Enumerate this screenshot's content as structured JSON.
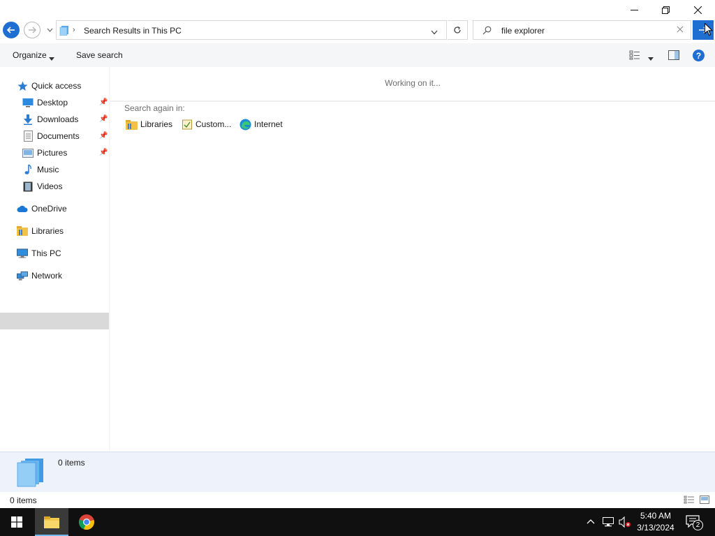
{
  "window": {
    "address_path": "Search Results in This PC",
    "search_query": "file explorer"
  },
  "commands": {
    "organize": "Organize",
    "save_search": "Save search",
    "help": "?"
  },
  "nav_pane": {
    "quick_access": "Quick access",
    "quick_items": [
      {
        "label": "Desktop",
        "icon": "desktop-icon",
        "pinned": true
      },
      {
        "label": "Downloads",
        "icon": "downloads-icon",
        "pinned": true
      },
      {
        "label": "Documents",
        "icon": "documents-icon",
        "pinned": true
      },
      {
        "label": "Pictures",
        "icon": "pictures-icon",
        "pinned": true
      },
      {
        "label": "Music",
        "icon": "music-icon",
        "pinned": false
      },
      {
        "label": "Videos",
        "icon": "videos-icon",
        "pinned": false
      }
    ],
    "onedrive": "OneDrive",
    "libraries": "Libraries",
    "this_pc": "This PC",
    "network": "Network",
    "selected": "This PC"
  },
  "content": {
    "status_message": "Working on it...",
    "search_again_label": "Search again in:",
    "search_locations": [
      "Libraries",
      "Custom...",
      "Internet"
    ]
  },
  "details": {
    "count": "0 items"
  },
  "statusbar": {
    "count": "0 items"
  },
  "taskbar": {
    "time": "5:40 AM",
    "date": "3/13/2024",
    "notification_count": "2"
  },
  "colors": {
    "accent": "#1e6fd1",
    "taskbar": "#101010",
    "details_bg": "#eef3fb",
    "selected_bg": "#d9d9d9"
  }
}
